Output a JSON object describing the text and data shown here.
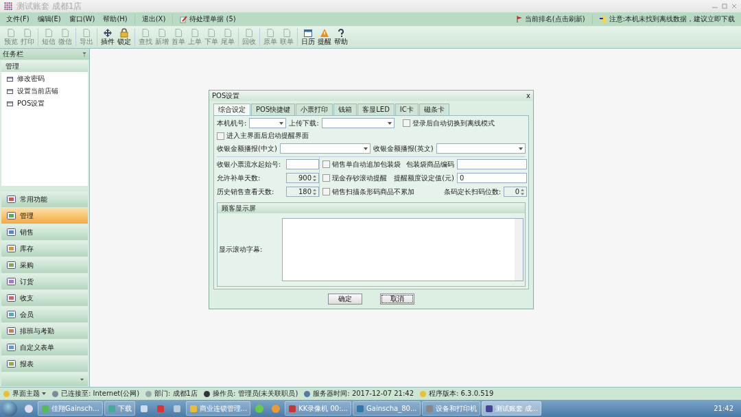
{
  "window": {
    "title": "测试账套 成都1店"
  },
  "menu": [
    {
      "label": "文件(F)"
    },
    {
      "label": "编辑(E)"
    },
    {
      "label": "窗口(W)"
    },
    {
      "label": "帮助(H)"
    },
    {
      "label": "退出(X)"
    },
    {
      "label": "待处理单据 (5)"
    }
  ],
  "notices": [
    "当前排名(点击刷新)",
    "注意:本机未找到离线数据，建议立即下载"
  ],
  "toolbar": [
    {
      "label": "预览",
      "disabled": true
    },
    {
      "label": "打印",
      "disabled": true
    },
    {
      "label": "短信",
      "disabled": true
    },
    {
      "label": "微信",
      "disabled": true
    },
    {
      "label": "导出",
      "disabled": true
    },
    {
      "label": "插件",
      "disabled": false
    },
    {
      "label": "锁定",
      "disabled": false
    },
    {
      "label": "查找",
      "disabled": true
    },
    {
      "label": "新增",
      "disabled": true
    },
    {
      "label": "首单",
      "disabled": true
    },
    {
      "label": "上单",
      "disabled": true
    },
    {
      "label": "下单",
      "disabled": true
    },
    {
      "label": "尾单",
      "disabled": true
    },
    {
      "label": "回收",
      "disabled": true
    },
    {
      "label": "原单",
      "disabled": true
    },
    {
      "label": "联单",
      "disabled": true
    },
    {
      "label": "日历",
      "disabled": false
    },
    {
      "label": "提醒",
      "disabled": false
    },
    {
      "label": "帮助",
      "disabled": false
    }
  ],
  "sidebar": {
    "title": "任务栏",
    "pin": "ᛘ",
    "section": "管理",
    "items": [
      "修改密码",
      "设置当前店铺",
      "POS设置"
    ],
    "nav": [
      {
        "label": "常用功能",
        "selected": false
      },
      {
        "label": "管理",
        "selected": true
      },
      {
        "label": "销售",
        "selected": false
      },
      {
        "label": "库存",
        "selected": false
      },
      {
        "label": "采购",
        "selected": false
      },
      {
        "label": "订货",
        "selected": false
      },
      {
        "label": "收支",
        "selected": false
      },
      {
        "label": "会员",
        "selected": false
      },
      {
        "label": "排班与考勤",
        "selected": false
      },
      {
        "label": "自定义表单",
        "selected": false
      },
      {
        "label": "报表",
        "selected": false
      }
    ]
  },
  "dialog": {
    "title": "POS设置",
    "close": "x",
    "tabs": [
      {
        "label": "综合设定",
        "selected": true
      },
      {
        "label": "POS快捷键",
        "selected": false
      },
      {
        "label": "小票打印",
        "selected": false
      },
      {
        "label": "钱箱",
        "selected": false
      },
      {
        "label": "客显LED",
        "selected": false
      },
      {
        "label": "IC卡",
        "selected": false
      },
      {
        "label": "磁条卡",
        "selected": false
      }
    ],
    "form": {
      "machine_no_label": "本机机号:",
      "upload_label": "上传下载:",
      "offline_mode": {
        "label": "登录后自动切换到离线模式",
        "checked": false
      },
      "auto_remind": {
        "label": "进入主界面后启动提醒界面",
        "checked": false
      },
      "voice_cn_label": "收银金额播报(中文)",
      "voice_en_label": "收银金额播报(英文)",
      "receipt_start_label": "收银小票流水起始号:",
      "supplement_days": {
        "label": "允许补单天数:",
        "value": "900"
      },
      "history_days": {
        "label": "历史销售查看天数:",
        "value": "180"
      },
      "options": [
        {
          "label": "销售单自动追加包装袋",
          "checked": false
        },
        {
          "label": "现金存钞滚动提醒",
          "checked": false
        },
        {
          "label": "销售扫描条形码商品不累加",
          "checked": false
        }
      ],
      "bag_code_label": "包装袋商品编码",
      "remind_amount": {
        "label": "提醒额度设定值(元)",
        "value": "0"
      },
      "barcode_digits": {
        "label": "条码定长扫码位数:",
        "value": "0"
      }
    },
    "customer_display": {
      "title": "顾客显示屏",
      "scroll_label": "显示滚动字幕:"
    },
    "buttons": [
      "确定",
      "取消"
    ]
  },
  "status_bar": [
    "界面主题",
    "已连接至: Internet(公网)",
    "部门: 成都1店",
    "操作员: 管理员(未关联职员)",
    "服务器时间: 2017-12-07 21:42",
    "程序版本: 6.3.0.519"
  ],
  "taskbar": {
    "items": [
      {
        "label": "佳翔Gainsch...",
        "active": false
      },
      {
        "label": "下载",
        "active": false
      },
      {
        "label": "商业连锁管理...",
        "active": false
      },
      {
        "label": "KK录像机 00:...",
        "active": false
      },
      {
        "label": "Gainscha_80...",
        "active": false
      },
      {
        "label": "设备和打印机",
        "active": false
      },
      {
        "label": "测试账套 成...",
        "active": true
      }
    ],
    "clock": "21:42"
  }
}
